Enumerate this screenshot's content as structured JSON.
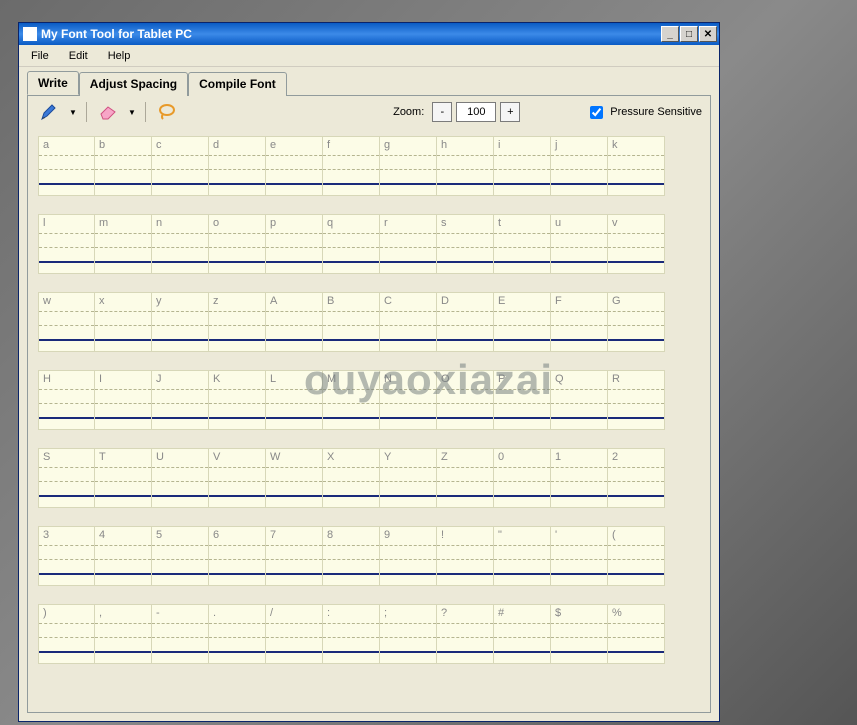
{
  "window": {
    "title": "My Font Tool for Tablet PC"
  },
  "menubar": {
    "items": [
      "File",
      "Edit",
      "Help"
    ]
  },
  "tabs": {
    "items": [
      {
        "label": "Write",
        "active": true
      },
      {
        "label": "Adjust Spacing",
        "active": false
      },
      {
        "label": "Compile Font",
        "active": false
      }
    ]
  },
  "toolbar": {
    "zoom_label": "Zoom:",
    "zoom_minus": "-",
    "zoom_value": "100",
    "zoom_plus": "+",
    "pressure_label": "Pressure Sensitive",
    "pressure_checked": true,
    "tools": {
      "pen": "pen",
      "eraser": "eraser",
      "lasso": "lasso"
    }
  },
  "grid": {
    "rows": [
      [
        "a",
        "b",
        "c",
        "d",
        "e",
        "f",
        "g",
        "h",
        "i",
        "j",
        "k"
      ],
      [
        "l",
        "m",
        "n",
        "o",
        "p",
        "q",
        "r",
        "s",
        "t",
        "u",
        "v"
      ],
      [
        "w",
        "x",
        "y",
        "z",
        "A",
        "B",
        "C",
        "D",
        "E",
        "F",
        "G"
      ],
      [
        "H",
        "I",
        "J",
        "K",
        "L",
        "M",
        "N",
        "O",
        "P",
        "Q",
        "R"
      ],
      [
        "S",
        "T",
        "U",
        "V",
        "W",
        "X",
        "Y",
        "Z",
        "0",
        "1",
        "2"
      ],
      [
        "3",
        "4",
        "5",
        "6",
        "7",
        "8",
        "9",
        "!",
        "\"",
        "'",
        "("
      ],
      [
        ")",
        ",",
        "-",
        ".",
        "/",
        ":",
        ";",
        "?",
        "#",
        "$",
        "%"
      ]
    ]
  },
  "watermark": "ouyaoxiazai"
}
